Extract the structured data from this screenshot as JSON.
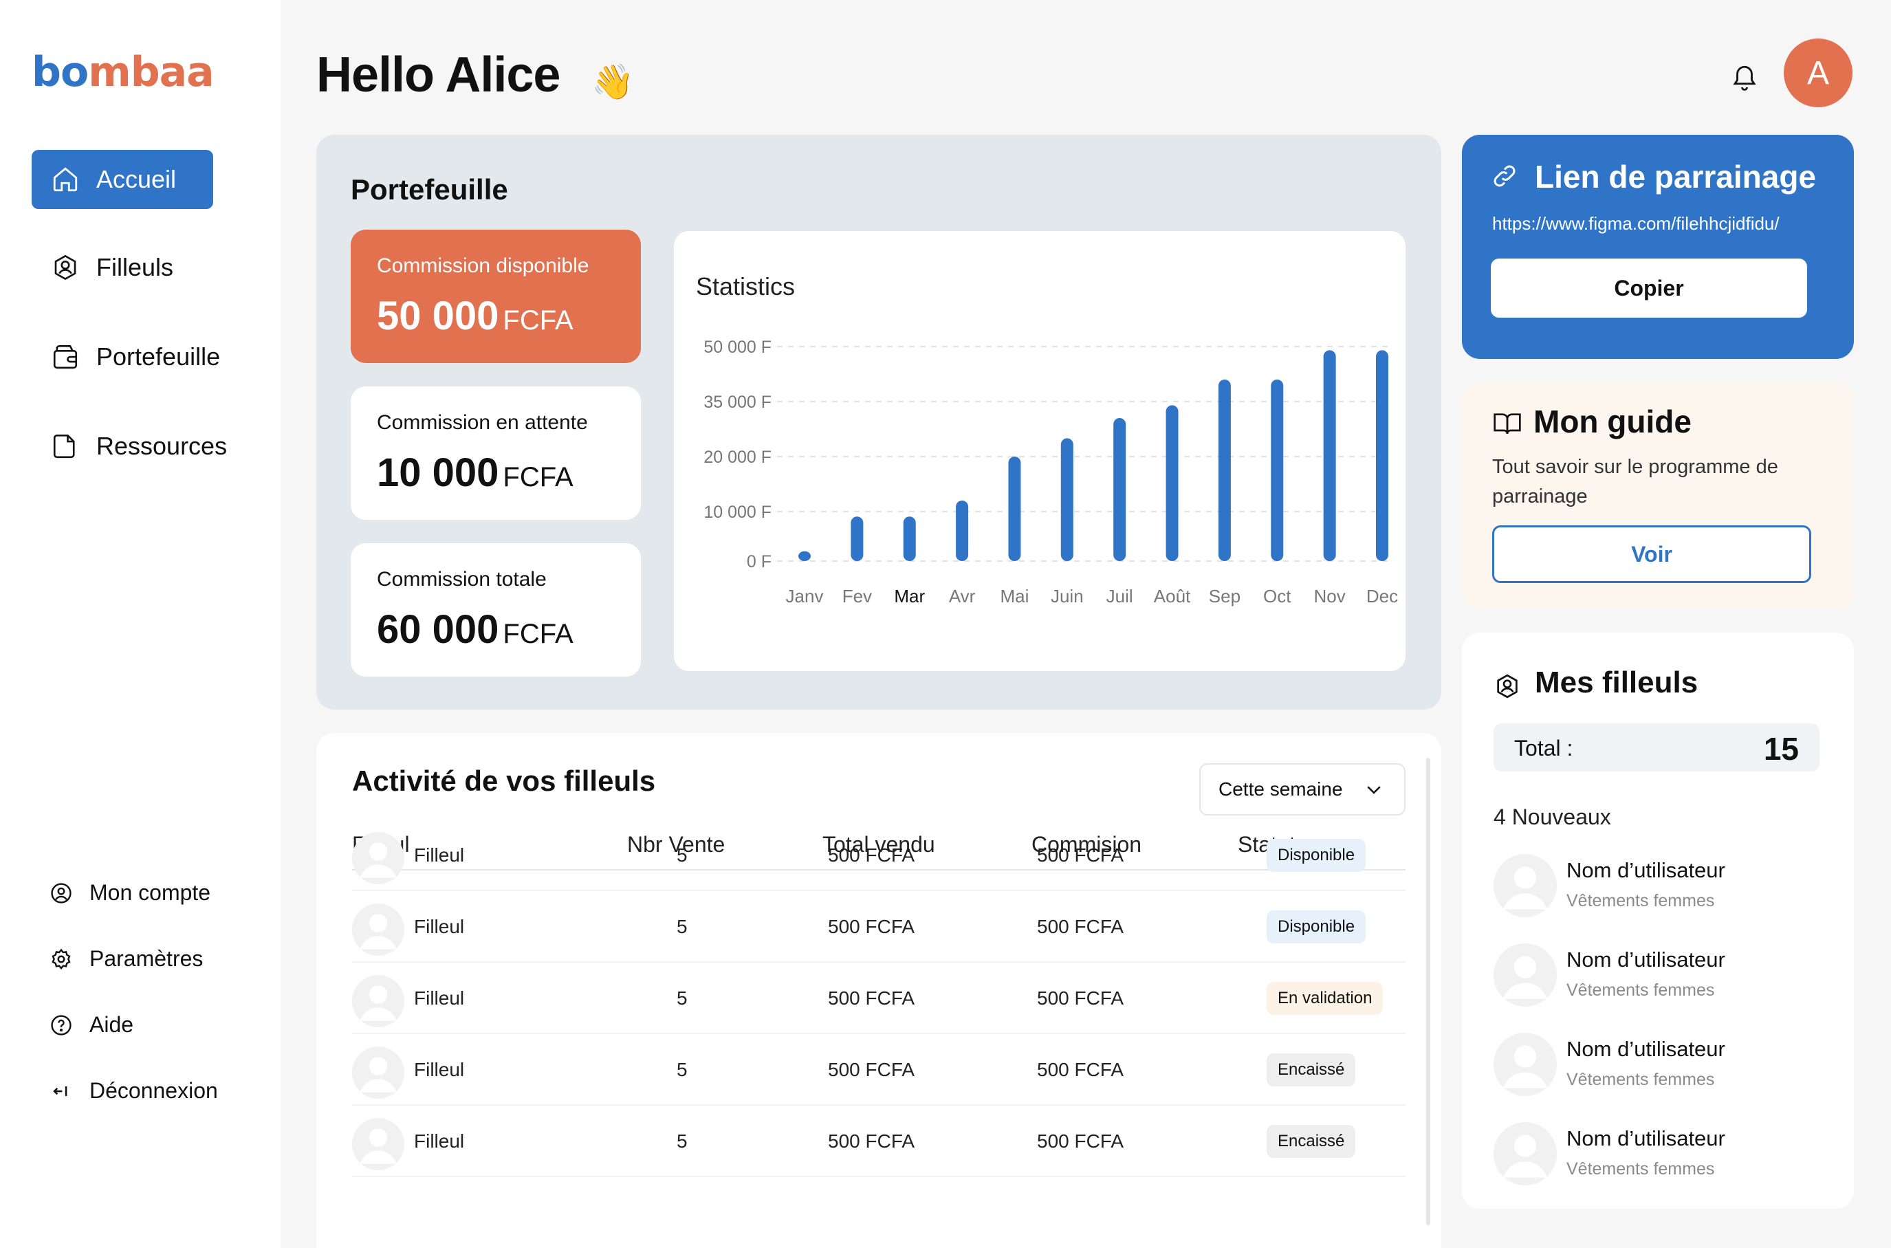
{
  "brand": {
    "logo_b": "b",
    "logo_rest_1": "o",
    "logo_rest_2": "mbaa"
  },
  "sidebar": {
    "items": [
      {
        "label": "Accueil",
        "icon": "home-icon",
        "active": true
      },
      {
        "label": "Filleuls",
        "icon": "user-badge-icon"
      },
      {
        "label": "Portefeuille",
        "icon": "wallet-icon"
      },
      {
        "label": "Ressources",
        "icon": "document-icon"
      }
    ],
    "footer": [
      {
        "label": "Mon compte",
        "icon": "user-circle-icon"
      },
      {
        "label": "Paramètres",
        "icon": "gear-icon"
      },
      {
        "label": "Aide",
        "icon": "help-icon"
      },
      {
        "label": "Déconnexion",
        "icon": "logout-icon"
      }
    ]
  },
  "header": {
    "greeting": "Hello Alice",
    "wave": "👋",
    "avatar_letter": "A"
  },
  "wallet": {
    "title": "Portefeuille",
    "cards": [
      {
        "label": "Commission disponible",
        "amount": "50 000",
        "unit": "FCFA"
      },
      {
        "label": "Commission en attente",
        "amount": "10 000",
        "unit": "FCFA"
      },
      {
        "label": "Commission totale",
        "amount": "60 000",
        "unit": "FCFA"
      }
    ]
  },
  "chart_data": {
    "type": "bar",
    "title": "Statistics",
    "categories": [
      "Janv",
      "Fev",
      "Mar",
      "Avr",
      "Mai",
      "Juin",
      "Juil",
      "Août",
      "Sep",
      "Oct",
      "Nov",
      "Dec"
    ],
    "values": [
      2000,
      9000,
      9000,
      12000,
      20000,
      25000,
      30500,
      34000,
      41000,
      41000,
      49000,
      49000
    ],
    "yticks": [
      "50 000 F",
      "35 000 F",
      "20 000 F",
      "10 000 F",
      "0 F"
    ],
    "ylim": [
      0,
      50000
    ],
    "highlight_category": "Mar",
    "bar_color": "#2f74c7"
  },
  "activity": {
    "title": "Activité de vos filleuls",
    "filter": "Cette semaine",
    "columns": [
      "Filleul",
      "Nbr Vente",
      "Total vendu",
      "Commision",
      "Statut"
    ],
    "rows": [
      {
        "name": "Filleul",
        "sales": "5",
        "total": "500 FCFA",
        "commission": "500 FCFA",
        "status": "Disponible",
        "kind": "dispo"
      },
      {
        "name": "Filleul",
        "sales": "5",
        "total": "500 FCFA",
        "commission": "500 FCFA",
        "status": "Disponible",
        "kind": "dispo"
      },
      {
        "name": "Filleul",
        "sales": "5",
        "total": "500 FCFA",
        "commission": "500 FCFA",
        "status": "En validation",
        "kind": "valid"
      },
      {
        "name": "Filleul",
        "sales": "5",
        "total": "500 FCFA",
        "commission": "500 FCFA",
        "status": "Encaissé",
        "kind": "enc"
      },
      {
        "name": "Filleul",
        "sales": "5",
        "total": "500 FCFA",
        "commission": "500 FCFA",
        "status": "Encaissé",
        "kind": "enc"
      }
    ]
  },
  "referral": {
    "title": "Lien de parrainage",
    "url": "https://www.figma.com/filehhcjidfidu/",
    "copy_label": "Copier"
  },
  "guide": {
    "title": "Mon guide",
    "text": "Tout savoir sur le programme de parrainage",
    "button": "Voir"
  },
  "my_filleuls": {
    "title": "Mes filleuls",
    "total_label": "Total :",
    "total_value": "15",
    "new_label": "4 Nouveaux",
    "users": [
      {
        "name": "Nom d’utilisateur",
        "category": "Vêtements femmes"
      },
      {
        "name": "Nom d’utilisateur",
        "category": "Vêtements femmes"
      },
      {
        "name": "Nom d’utilisateur",
        "category": "Vêtements femmes"
      },
      {
        "name": "Nom d’utilisateur",
        "category": "Vêtements femmes"
      }
    ]
  }
}
